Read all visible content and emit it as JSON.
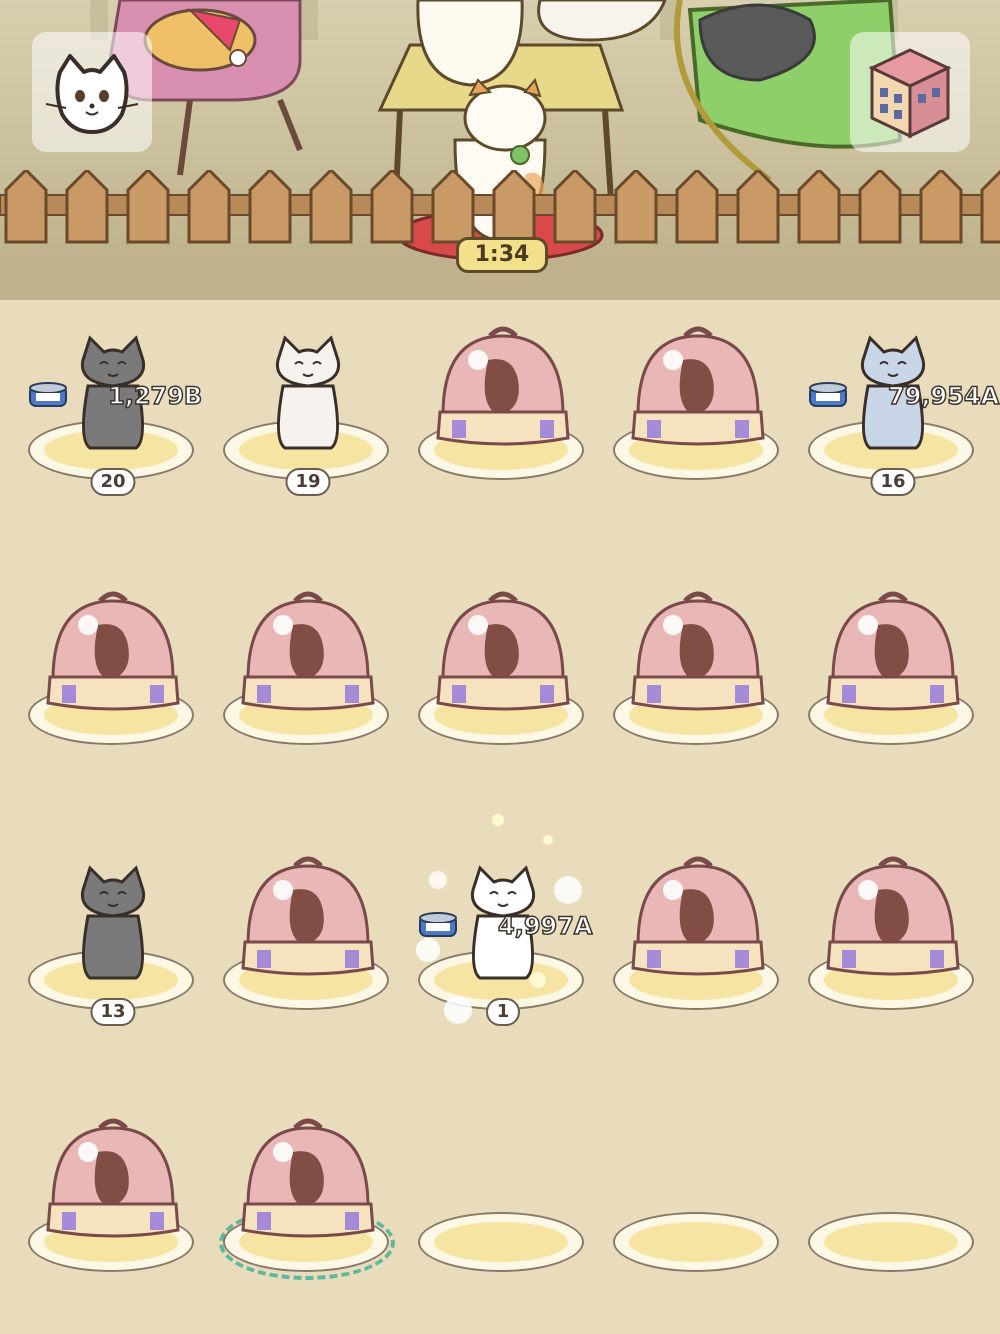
{
  "hud": {
    "cat_menu_icon": "cat-face-icon",
    "building_icon": "apartment-building-icon",
    "timer": "1:34"
  },
  "colors": {
    "background": "#e8dcbc",
    "plate_inner": "#f5e4a2",
    "highlight_ring": "#5fb79c",
    "dome_pink": "#e9b8b6"
  },
  "slots": [
    {
      "type": "cat",
      "level": "20",
      "earn": "1,279B",
      "tuna": true
    },
    {
      "type": "cat",
      "level": "19"
    },
    {
      "type": "carrier"
    },
    {
      "type": "carrier"
    },
    {
      "type": "cat",
      "level": "16",
      "earn": "79,954A",
      "tuna": true
    },
    {
      "type": "carrier"
    },
    {
      "type": "carrier"
    },
    {
      "type": "carrier"
    },
    {
      "type": "carrier"
    },
    {
      "type": "carrier"
    },
    {
      "type": "cat",
      "level": "13"
    },
    {
      "type": "carrier"
    },
    {
      "type": "cat",
      "level": "1",
      "earn": "4,997A",
      "tuna": true,
      "sparkle": true
    },
    {
      "type": "carrier"
    },
    {
      "type": "carrier"
    },
    {
      "type": "carrier"
    },
    {
      "type": "carrier",
      "selected": true
    },
    {
      "type": "empty"
    },
    {
      "type": "empty"
    },
    {
      "type": "empty"
    }
  ]
}
